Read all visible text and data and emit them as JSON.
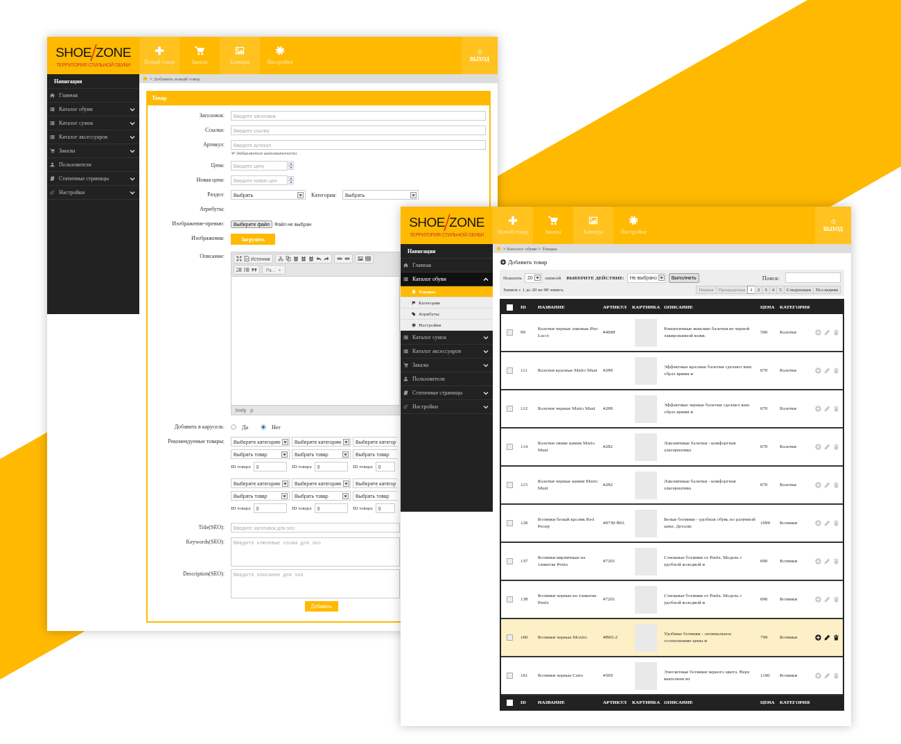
{
  "editor_window": {
    "header": {
      "logo": [
        "SHOE",
        "ZONE"
      ],
      "tagline": "ТЕРРИТОРИЯ СТИЛЬНОЙ ОБУВИ",
      "nav": [
        "Новый товар",
        "Заказы",
        "Баннера",
        "Настройки"
      ],
      "logout": "ВЫХОД"
    },
    "sidebar": {
      "title": "Навигация",
      "items": [
        {
          "label": "Главная",
          "kind": "link"
        },
        {
          "label": "Каталог обуви",
          "kind": "group",
          "expanded": false
        },
        {
          "label": "Каталог сумок",
          "kind": "group",
          "expanded": false
        },
        {
          "label": "Каталог аксессуаров",
          "kind": "group",
          "expanded": false
        },
        {
          "label": "Заказы",
          "kind": "group",
          "expanded": false
        },
        {
          "label": "Пользователи",
          "kind": "link"
        },
        {
          "label": "Статичные страницы",
          "kind": "group",
          "expanded": false
        },
        {
          "label": "Настройки",
          "kind": "group",
          "expanded": false
        }
      ]
    },
    "breadcrumb": "> Добавить новый товар",
    "panel_title": "Товар",
    "fields": [
      {
        "kind": "text",
        "label": "Заголовок:",
        "placeholder": "Введите заголовок"
      },
      {
        "kind": "text",
        "label": "Ссылка:",
        "placeholder": "Введите ссылку"
      },
      {
        "kind": "text",
        "label": "Артикул:",
        "placeholder": "Введите артикул",
        "hint": "'#' добавляется автоматически"
      },
      {
        "kind": "number",
        "label": "Цена:",
        "placeholder": "Введите цену"
      },
      {
        "kind": "number",
        "label": "Новая цена:",
        "placeholder": "Введите новую цен"
      },
      {
        "kind": "select_pair",
        "label": "Раздел:",
        "value": "Выбрать",
        "label_2": "Категория:",
        "value_2": "Выбрать"
      },
      {
        "kind": "empty",
        "label": "Атрибуты:"
      },
      {
        "kind": "file",
        "label": "Изображение-превью:",
        "button": "Выберите файл",
        "status": "Файл не выбран"
      },
      {
        "kind": "upload",
        "label": "Изображения:",
        "button": "Загрузить"
      },
      {
        "kind": "editor",
        "label": "Описание:",
        "source": "Источник",
        "format": "Ра...",
        "path": [
          "body",
          "p"
        ]
      },
      {
        "kind": "radio",
        "label": "Добавить в карусель:",
        "options": [
          {
            "label": "Да",
            "selected": false
          },
          {
            "label": "Нет",
            "selected": true
          }
        ]
      },
      {
        "kind": "recommend",
        "label": "Рекомендуемые товары:",
        "groups": [
          [
            {
              "category": "Выберите категорию",
              "product": "Выбрать товар",
              "id_label": "ID товара",
              "id_value": "0"
            },
            {
              "category": "Выберите категорию",
              "product": "Выбрать товар",
              "id_label": "ID товара",
              "id_value": "0"
            },
            {
              "category": "Выберите категор",
              "product": "Выбрать товар",
              "id_label": "ID товара",
              "id_value": "0"
            }
          ],
          [
            {
              "category": "Выберите категорию",
              "product": "Выбрать товар",
              "id_label": "ID товара",
              "id_value": "0"
            },
            {
              "category": "Выберите категорию",
              "product": "Выбрать товар",
              "id_label": "ID товара",
              "id_value": "0"
            },
            {
              "category": "Выберите категор",
              "product": "Выбрать товар",
              "id_label": "ID товара",
              "id_value": "0"
            }
          ]
        ]
      },
      {
        "kind": "text",
        "label": "Title(SEO):",
        "placeholder": "Введите заголовок для seo"
      },
      {
        "kind": "textarea",
        "label": "Keywords(SEO):",
        "placeholder": "Введите ключевые слова для seo"
      },
      {
        "kind": "textarea",
        "label": "Description(SEO):",
        "placeholder": "Введите описание для seo"
      }
    ],
    "submit": "Добавить"
  },
  "list_window": {
    "header": {
      "logo": [
        "SHOE",
        "ZONE"
      ],
      "tagline": "ТЕРРИТОРИЯ СТИЛЬНОЙ ОБУВИ",
      "nav": [
        "Новый товар",
        "Заказы",
        "Баннера",
        "Настройки"
      ],
      "logout": "ВЫХОД"
    },
    "sidebar": {
      "title": "Навигация",
      "items": [
        {
          "label": "Главная",
          "kind": "link"
        },
        {
          "label": "Каталог обуви",
          "kind": "group",
          "expanded": true,
          "children": [
            {
              "label": "Товары",
              "selected": true
            },
            {
              "label": "Категории",
              "selected": false
            },
            {
              "label": "Атрибуты",
              "selected": false
            },
            {
              "label": "Настройки",
              "selected": false
            }
          ]
        },
        {
          "label": "Каталог сумок",
          "kind": "group",
          "expanded": false
        },
        {
          "label": "Каталог аксессуаров",
          "kind": "group",
          "expanded": false
        },
        {
          "label": "Заказы",
          "kind": "group",
          "expanded": false
        },
        {
          "label": "Пользователи",
          "kind": "link"
        },
        {
          "label": "Статичные страницы",
          "kind": "group",
          "expanded": false
        },
        {
          "label": "Настройки",
          "kind": "group",
          "expanded": false
        }
      ]
    },
    "breadcrumb": "> Каталог обуви > Товары",
    "add_label": "Добавить товар",
    "toolbar": {
      "show_label": "Показать",
      "page_size": "20",
      "entries_label": "записей",
      "action_label": "ВЫБЕРИТЕ ДЕЙСТВИЕ:",
      "action": "Не выбрано",
      "run": "Выполнить",
      "search_label": "Поиск:"
    },
    "info": "Записи с 1 до 20 из 98 запись",
    "pagination": [
      {
        "label": "Первая",
        "selected": false,
        "disabled": true
      },
      {
        "label": "Предыдущая",
        "selected": false,
        "disabled": true
      },
      {
        "label": "1",
        "selected": true,
        "disabled": false
      },
      {
        "label": "2",
        "selected": false,
        "disabled": false
      },
      {
        "label": "3",
        "selected": false,
        "disabled": false
      },
      {
        "label": "4",
        "selected": false,
        "disabled": false
      },
      {
        "label": "5",
        "selected": false,
        "disabled": false
      },
      {
        "label": "Следующая",
        "selected": false,
        "disabled": false
      },
      {
        "label": "Последняя",
        "selected": false,
        "disabled": false
      }
    ],
    "table": {
      "header_checked": false,
      "columns": [
        "ID",
        "НАЗВАНИЕ",
        "АРТИКУЛ",
        "КАРТИНКА",
        "ОПИСАНИЕ",
        "ЦЕНА",
        "КАТЕГОРИЯ"
      ],
      "rows": [
        {
          "checked": false,
          "selected": false,
          "id": "99",
          "name": "Балетки черные лаковые Pier Lucci",
          "article": "#4068",
          "description": "Романтичные женские балетки из черной лакированной кожи.",
          "price": "590",
          "category": "Балетки"
        },
        {
          "checked": false,
          "selected": false,
          "id": "111",
          "name": "Балетки красные Mario Muzi",
          "article": "#288",
          "description": "Эффектные красные балетки сделают ваш образ ярким и",
          "price": "670",
          "category": "Балетки"
        },
        {
          "checked": false,
          "selected": false,
          "id": "112",
          "name": "Балетки черные Mario Muzi",
          "article": "#288",
          "description": "Эффектные черные балетки сделают ваш образ ярким и",
          "price": "670",
          "category": "Балетки"
        },
        {
          "checked": false,
          "selected": false,
          "id": "114",
          "name": "Балетки синие камни Mario Muzi",
          "article": "#282",
          "description": "Лаконичные балетки - комфортная альтернатива",
          "price": "670",
          "category": "Балетки"
        },
        {
          "checked": false,
          "selected": false,
          "id": "115",
          "name": "Балетки черные камни Mario Muzi",
          "article": "#282",
          "description": "Лаконичные балетки - комфортная альтернатива",
          "price": "670",
          "category": "Балетки"
        },
        {
          "checked": false,
          "selected": false,
          "id": "126",
          "name": "Ботинки белый кролик Red Peony",
          "article": "#6730-B01",
          "description": "Белые ботинки - удобная обувь по разумной цене. Детали:",
          "price": "1099",
          "category": "Ботинки"
        },
        {
          "checked": false,
          "selected": false,
          "id": "137",
          "name": "Ботинки кирпичные на танкетке Penla",
          "article": "#7201",
          "description": "Стильные ботинки от Penla. Модель с удобной колодкой и",
          "price": "690",
          "category": "Ботинки"
        },
        {
          "checked": false,
          "selected": false,
          "id": "138",
          "name": "Ботинки черные на танкетке Penla",
          "article": "#7201",
          "description": "Стильные ботинки от Penla. Модель с удобной колодкой и",
          "price": "690",
          "category": "Ботинки"
        },
        {
          "checked": false,
          "selected": true,
          "id": "160",
          "name": "Ботинки черные Moxito",
          "article": "#B65-2",
          "description": "Удобные ботинки - оптимальное соотношение цены и",
          "price": "799",
          "category": "Ботинки"
        },
        {
          "checked": false,
          "selected": false,
          "id": "161",
          "name": "Ботинки черные Cetto",
          "article": "#509",
          "description": "Элегантные ботинки черного цвета. Верх выполнен из",
          "price": "1190",
          "category": "Ботинки"
        }
      ],
      "footer_columns": [
        "ID",
        "НАЗВАНИЕ",
        "АРТИКУЛ",
        "КАРТИНКА",
        "ОПИСАНИЕ",
        "ЦЕНА",
        "КАТЕГОРИЯ"
      ]
    }
  }
}
